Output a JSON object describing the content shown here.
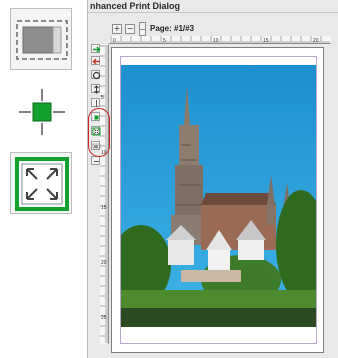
{
  "window": {
    "title": "nhanced Print Dialog"
  },
  "toolbar": {
    "zoom_in": "+",
    "zoom_out": "−",
    "page_label": "Page: #1/#3"
  },
  "ruler": {
    "top_marks": [
      "0",
      "5",
      "10",
      "15",
      "20"
    ],
    "left_marks": [
      "5",
      "10",
      "15",
      "20",
      "25"
    ]
  },
  "tools": [
    {
      "name": "move-right-icon"
    },
    {
      "name": "move-left-icon"
    },
    {
      "name": "rotate-icon"
    },
    {
      "name": "fit-height-icon"
    },
    {
      "name": "center-icon"
    },
    {
      "name": "fit-page-icon"
    },
    {
      "name": "fit-width-icon"
    }
  ],
  "big_icons": [
    {
      "name": "fit-width-icon"
    },
    {
      "name": "center-icon"
    },
    {
      "name": "fit-page-icon"
    }
  ],
  "colors": {
    "accent_green": "#13a02c",
    "highlight_red": "#d02020",
    "margin_line": "#b7a6c8"
  },
  "preview": {
    "image": "cathedral-photo"
  }
}
